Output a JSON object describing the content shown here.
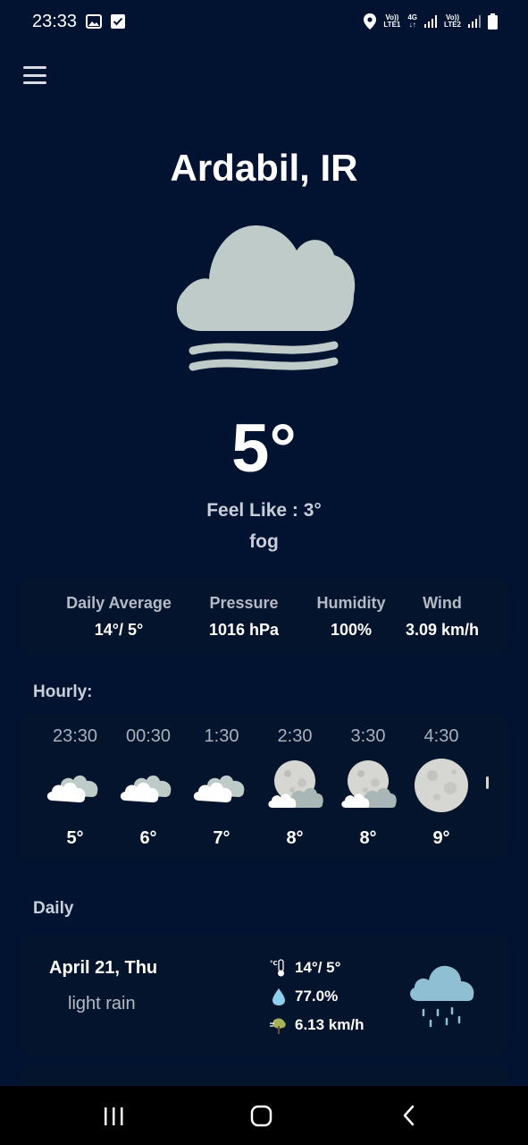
{
  "status_bar": {
    "time": "23:33",
    "net1": "Vo))",
    "net1_sub": "LTE1",
    "net_type": "4G",
    "net2": "Vo))",
    "net2_sub": "LTE2"
  },
  "location": "Ardabil, IR",
  "current": {
    "temp": "5°",
    "feels_like": "Feel Like : 3°",
    "condition": "fog",
    "icon": "fog-icon"
  },
  "stats": [
    {
      "label": "Daily Average",
      "value": "14°/ 5°"
    },
    {
      "label": "Pressure",
      "value": "1016 hPa"
    },
    {
      "label": "Humidity",
      "value": "100%"
    },
    {
      "label": "Wind",
      "value": "3.09 km/h"
    }
  ],
  "hourly_title": "Hourly:",
  "hourly": [
    {
      "time": "23:30",
      "temp": "5°",
      "icon": "cloudy-icon"
    },
    {
      "time": "00:30",
      "temp": "6°",
      "icon": "cloudy-icon"
    },
    {
      "time": "1:30",
      "temp": "7°",
      "icon": "cloudy-icon"
    },
    {
      "time": "2:30",
      "temp": "8°",
      "icon": "moon-cloud-icon"
    },
    {
      "time": "3:30",
      "temp": "8°",
      "icon": "moon-cloud-icon"
    },
    {
      "time": "4:30",
      "temp": "9°",
      "icon": "full-moon-icon"
    }
  ],
  "daily_title": "Daily",
  "daily": [
    {
      "date": "April 21, Thu",
      "description": "light rain",
      "temp_range": "14°/ 5°",
      "humidity": "77.0%",
      "wind": "6.13 km/h",
      "icon": "rain-cloud-icon"
    }
  ],
  "colors": {
    "background": "#011331",
    "card": "#04142c",
    "cloud": "#bfcbc8",
    "rain_cloud": "#8fbfd3"
  }
}
